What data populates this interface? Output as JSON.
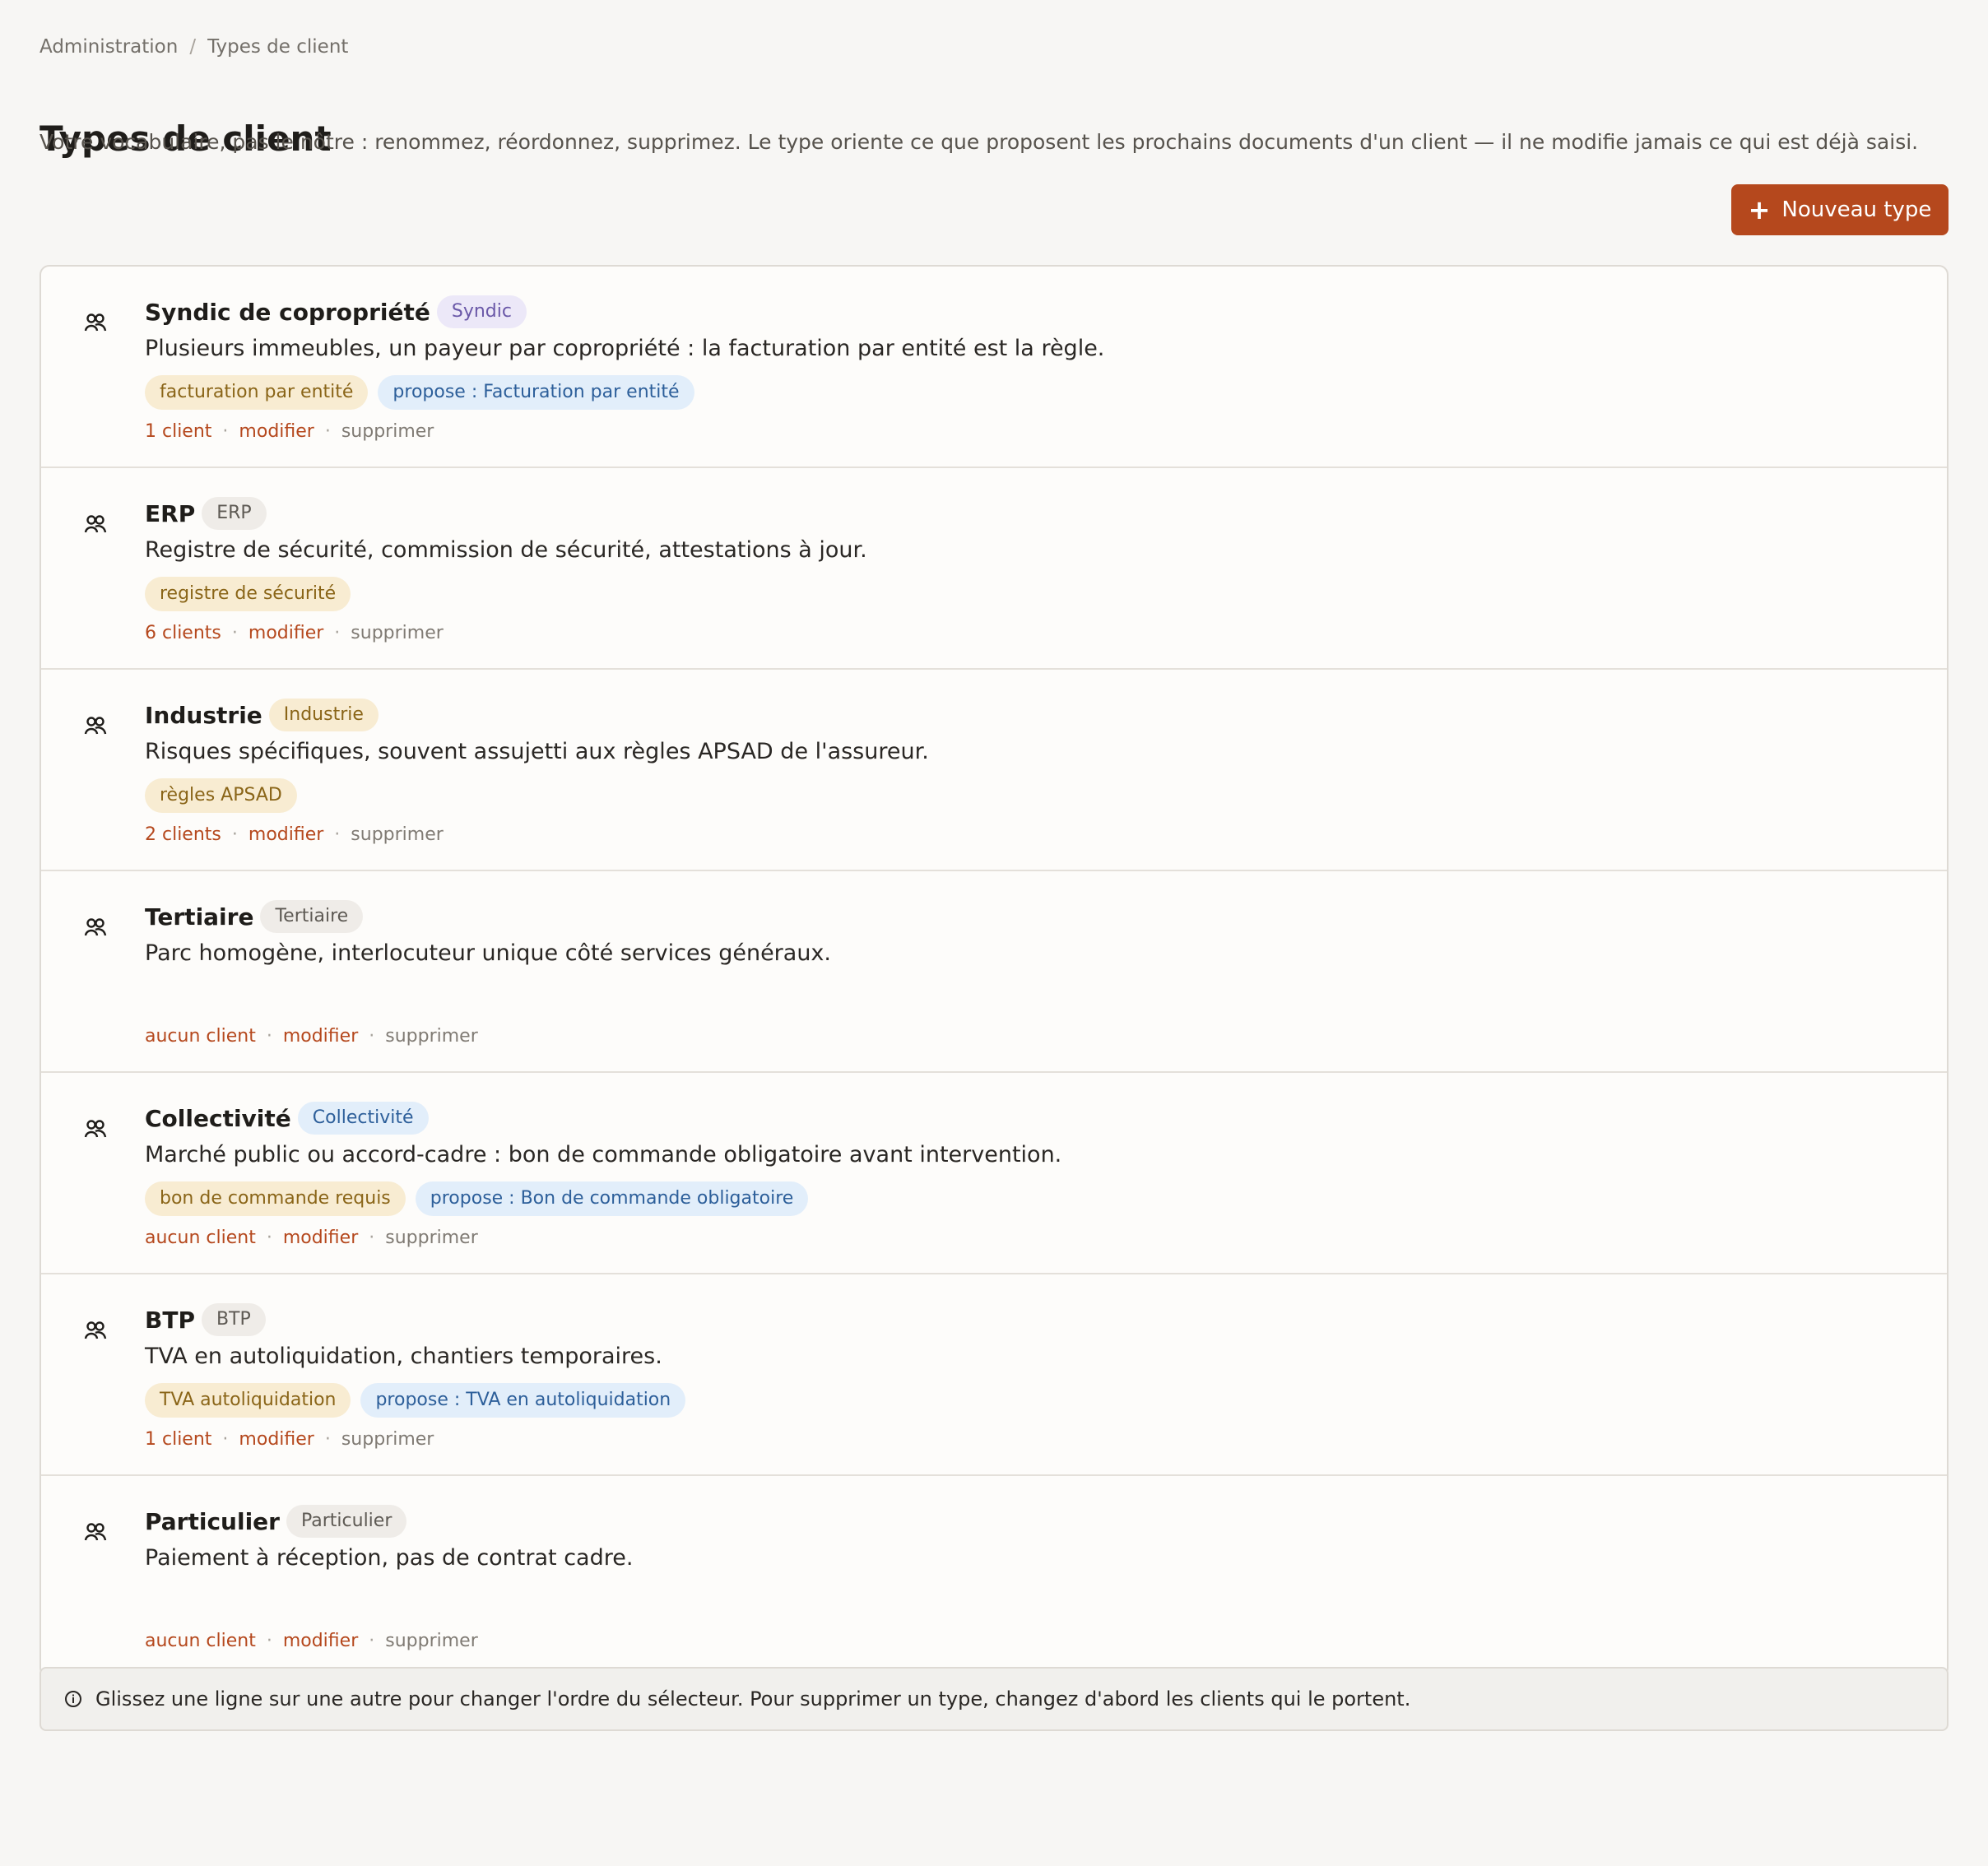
{
  "breadcrumb": {
    "root": "Administration",
    "separator": "/",
    "current": "Types de client"
  },
  "page": {
    "title": "Types de client",
    "subtitle": "Votre vocabulaire, pas le nôtre : renommez, réordonnez, supprimez. Le type oriente ce que proposent les prochains documents d'un client — il ne modifie jamais ce qui est déjà saisi."
  },
  "toolbar": {
    "new_label": "Nouveau type"
  },
  "types": [
    {
      "name": "Syndic de copropriété",
      "badge": "Syndic",
      "badge_color": "purple",
      "description": "Plusieurs immeubles, un payeur par copropriété : la facturation par entité est la règle.",
      "tags": [
        {
          "label": "facturation par entité",
          "color": "yellow"
        },
        {
          "label": "propose : Facturation par entité",
          "color": "blue"
        }
      ],
      "clients": "1 client",
      "edit": "modifier",
      "delete": "supprimer"
    },
    {
      "name": "ERP",
      "badge": "ERP",
      "badge_color": "grey",
      "description": "Registre de sécurité, commission de sécurité, attestations à jour.",
      "tags": [
        {
          "label": "registre de sécurité",
          "color": "yellow"
        }
      ],
      "clients": "6 clients",
      "edit": "modifier",
      "delete": "supprimer"
    },
    {
      "name": "Industrie",
      "badge": "Industrie",
      "badge_color": "yellow",
      "description": "Risques spécifiques, souvent assujetti aux règles APSAD de l'assureur.",
      "tags": [
        {
          "label": "règles APSAD",
          "color": "yellow"
        }
      ],
      "clients": "2 clients",
      "edit": "modifier",
      "delete": "supprimer"
    },
    {
      "name": "Tertiaire",
      "badge": "Tertiaire",
      "badge_color": "grey",
      "description": "Parc homogène, interlocuteur unique côté services généraux.",
      "tags": [],
      "clients": "aucun client",
      "edit": "modifier",
      "delete": "supprimer"
    },
    {
      "name": "Collectivité",
      "badge": "Collectivité",
      "badge_color": "blue",
      "description": "Marché public ou accord-cadre : bon de commande obligatoire avant intervention.",
      "tags": [
        {
          "label": "bon de commande requis",
          "color": "yellow"
        },
        {
          "label": "propose : Bon de commande obligatoire",
          "color": "blue"
        }
      ],
      "clients": "aucun client",
      "edit": "modifier",
      "delete": "supprimer"
    },
    {
      "name": "BTP",
      "badge": "BTP",
      "badge_color": "grey",
      "description": "TVA en autoliquidation, chantiers temporaires.",
      "tags": [
        {
          "label": "TVA autoliquidation",
          "color": "yellow"
        },
        {
          "label": "propose : TVA en autoliquidation",
          "color": "blue"
        }
      ],
      "clients": "1 client",
      "edit": "modifier",
      "delete": "supprimer"
    },
    {
      "name": "Particulier",
      "badge": "Particulier",
      "badge_color": "grey",
      "description": "Paiement à réception, pas de contrat cadre.",
      "tags": [],
      "clients": "aucun client",
      "edit": "modifier",
      "delete": "supprimer"
    }
  ],
  "hint": {
    "icon": "info-icon",
    "text": "Glissez une ligne sur une autre pour changer l'ordre du sélecteur. Pour supprimer un type, changez d'abord les clients qui le portent."
  },
  "colors": {
    "accent": "#b5481d",
    "background": "#f7f6f4"
  }
}
